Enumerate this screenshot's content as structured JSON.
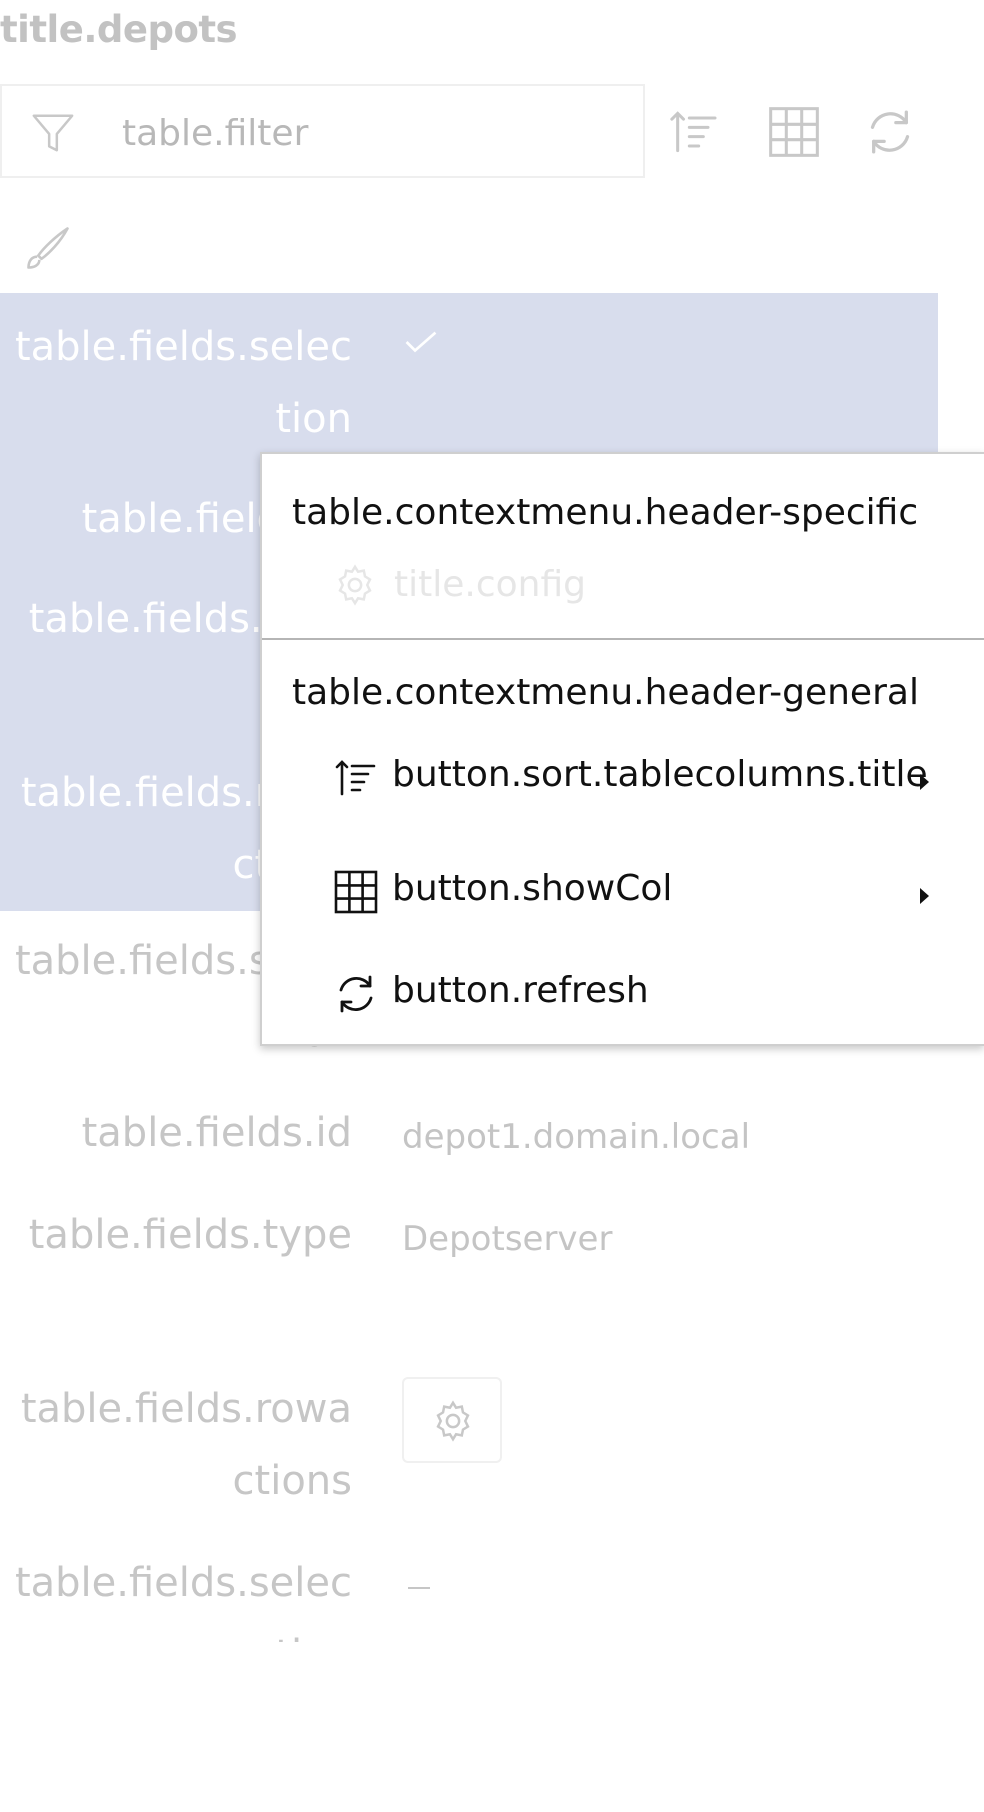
{
  "page": {
    "title": "title.depots"
  },
  "toolbar": {
    "filter_placeholder": "table.filter",
    "filter_icon": "filter-icon",
    "sort_icon": "sort-icon",
    "columns_icon": "grid-icon",
    "refresh_icon": "refresh-icon",
    "edit_icon": "brush-icon"
  },
  "table": {
    "selected_record": {
      "selection_label": "table.fields.selection",
      "id_label": "table.fields.id",
      "type_label": "table.fields.type",
      "rowactions_label": "table.fields.rowactions"
    },
    "record": {
      "selection_label": "table.fields.selection",
      "id_label": "table.fields.id",
      "id_value": "depot1.domain.local",
      "type_label": "table.fields.type",
      "type_value": "Depotserver",
      "rowactions_label": "table.fields.rowactions"
    },
    "next_record": {
      "selection_label": "table.fields.selection"
    }
  },
  "context_menu": {
    "header_specific": "table.contextmenu.header-specific",
    "config_label": "title.config",
    "header_general": "table.contextmenu.header-general",
    "items": [
      {
        "label": "button.sort.tablecolumns.title",
        "icon": "sort-icon",
        "submenu": true
      },
      {
        "label": "button.showCol",
        "icon": "grid-icon",
        "submenu": true
      },
      {
        "label": "button.refresh",
        "icon": "refresh-icon",
        "submenu": false
      }
    ]
  },
  "colors": {
    "selected_row": "#d8dded",
    "muted_text": "#c6c6c6",
    "menu_text": "#111111"
  }
}
